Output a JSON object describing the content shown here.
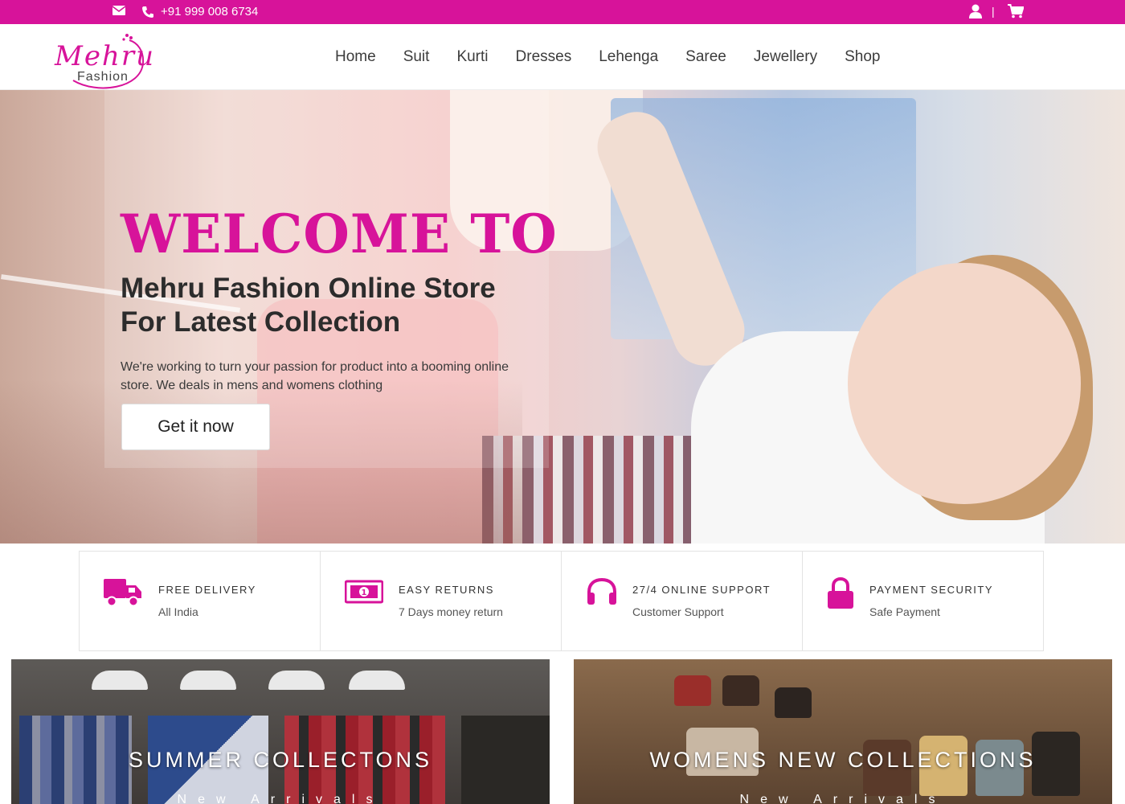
{
  "topbar": {
    "phone": "+91 999 008 6734",
    "separator": "|",
    "accent_color": "#d7139a"
  },
  "logo": {
    "primary": "Mehru",
    "secondary": "Fashion"
  },
  "nav": {
    "items": [
      "Home",
      "Suit",
      "Kurti",
      "Dresses",
      "Lehenga",
      "Saree",
      "Jewellery",
      "Shop"
    ]
  },
  "hero": {
    "welcome": "WELCOME TO",
    "tagline_line1": "Mehru Fashion Online Store",
    "tagline_line2": "For Latest Collection",
    "description": "We're working to turn your passion for product into a booming online store. We deals in mens and womens clothing",
    "cta": "Get it now"
  },
  "features": [
    {
      "icon": "truck-icon",
      "title": "FREE DELIVERY",
      "subtitle": "All India"
    },
    {
      "icon": "money-icon",
      "title": "EASY RETURNS",
      "subtitle": "7 Days money return"
    },
    {
      "icon": "headphones-icon",
      "title": "27/4 ONLINE SUPPORT",
      "subtitle": "Customer Support"
    },
    {
      "icon": "lock-icon",
      "title": "PAYMENT SECURITY",
      "subtitle": "Safe Payment"
    }
  ],
  "collections": [
    {
      "title": "SUMMER COLLECTONS",
      "subtitle": "New Arrivals"
    },
    {
      "title": "WOMENS NEW COLLECTIONS",
      "subtitle": "New Arrivals"
    }
  ]
}
